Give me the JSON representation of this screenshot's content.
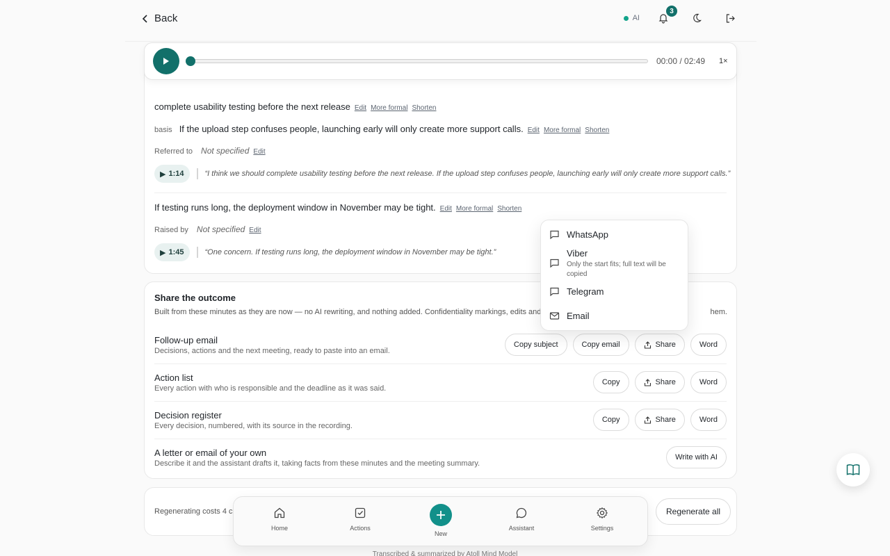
{
  "header": {
    "back_label": "Back",
    "ai_label": "AI",
    "notification_count": "3"
  },
  "player": {
    "time": "00:00 / 02:49",
    "speed": "1×",
    "progress": 0
  },
  "items": {
    "action1_text": "complete usability testing before the next release",
    "basis_label": "basis",
    "basis_text": "If the upload step confuses people, launching early will only create more support calls.",
    "referred_label": "Referred to",
    "not_specified": "Not specified",
    "quote1_time": "1:14",
    "quote1": "“I think we should complete usability testing before the next release. If the upload step confuses people, launching early will only create more support calls.”",
    "risk_text": "If testing runs long, the deployment window in November may be tight.",
    "raised_label": "Raised by",
    "quote2_time": "1:45",
    "quote2": "“One concern. If testing runs long, the deployment window in November may be tight.”",
    "edit": "Edit",
    "more_formal": "More formal",
    "shorten": "Shorten"
  },
  "share": {
    "title": "Share the outcome",
    "desc_start": "Built from these minutes as they are now — no AI rewriting, and nothing added. Confidentiality markings, edits and",
    "desc_end": "hem.",
    "rows": [
      {
        "title": "Follow-up email",
        "desc": "Decisions, actions and the next meeting, ready to paste into an email."
      },
      {
        "title": "Action list",
        "desc": "Every action with who is responsible and the deadline as it was said."
      },
      {
        "title": "Decision register",
        "desc": "Every decision, numbered, with its source in the recording."
      },
      {
        "title": "A letter or email of your own",
        "desc": "Describe it and the assistant drafts it, taking facts from these minutes and the meeting summary."
      }
    ],
    "copy_subject": "Copy subject",
    "copy_email": "Copy email",
    "copy": "Copy",
    "share": "Share",
    "word": "Word",
    "write_ai": "Write with AI"
  },
  "popup": {
    "whatsapp": "WhatsApp",
    "viber": "Viber",
    "viber_sub": "Only the start fits; full text will be copied",
    "telegram": "Telegram",
    "email": "Email"
  },
  "regen": {
    "text": "Regenerating costs 4 cr",
    "button": "Regenerate all"
  },
  "nav": {
    "home": "Home",
    "actions": "Actions",
    "new": "New",
    "assistant": "Assistant",
    "settings": "Settings"
  },
  "footer": "Transcribed & summarized by Atoll Mind Model",
  "colors": {
    "accent": "#12706a"
  }
}
